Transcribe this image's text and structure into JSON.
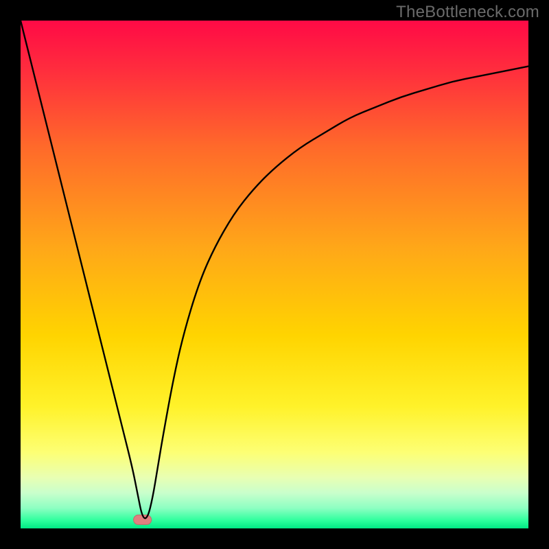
{
  "watermark": "TheBottleneck.com",
  "chart_data": {
    "type": "line",
    "title": "",
    "xlabel": "",
    "ylabel": "",
    "xlim": [
      0,
      100
    ],
    "ylim": [
      0,
      100
    ],
    "grid": false,
    "legend": false,
    "background_gradient": {
      "stops": [
        {
          "pos": 0.0,
          "color": "#ff0a46"
        },
        {
          "pos": 0.1,
          "color": "#ff2e3d"
        },
        {
          "pos": 0.25,
          "color": "#ff6a2a"
        },
        {
          "pos": 0.45,
          "color": "#ffa818"
        },
        {
          "pos": 0.62,
          "color": "#ffd400"
        },
        {
          "pos": 0.76,
          "color": "#fff22a"
        },
        {
          "pos": 0.85,
          "color": "#fdff74"
        },
        {
          "pos": 0.9,
          "color": "#e8ffb3"
        },
        {
          "pos": 0.93,
          "color": "#c9ffcc"
        },
        {
          "pos": 0.96,
          "color": "#8dffc2"
        },
        {
          "pos": 0.985,
          "color": "#2bff9c"
        },
        {
          "pos": 1.0,
          "color": "#00e884"
        }
      ]
    },
    "annotations": [
      {
        "name": "min-marker",
        "shape": "pill",
        "x": 24,
        "y": 1.7,
        "color": "#e08080"
      }
    ],
    "series": [
      {
        "name": "bottleneck-curve",
        "color": "#000000",
        "x": [
          0,
          4,
          8,
          12,
          16,
          20,
          22,
          23,
          24,
          25,
          26,
          27,
          28,
          30,
          32,
          35,
          38,
          42,
          46,
          50,
          55,
          60,
          65,
          70,
          75,
          80,
          85,
          90,
          95,
          100
        ],
        "y": [
          100,
          84,
          68,
          52,
          36,
          20,
          12,
          7,
          2,
          2,
          6,
          12,
          18,
          29,
          38,
          48,
          55,
          62,
          67,
          71,
          75,
          78,
          81,
          83,
          85,
          86.5,
          88,
          89,
          90,
          91
        ]
      }
    ]
  }
}
